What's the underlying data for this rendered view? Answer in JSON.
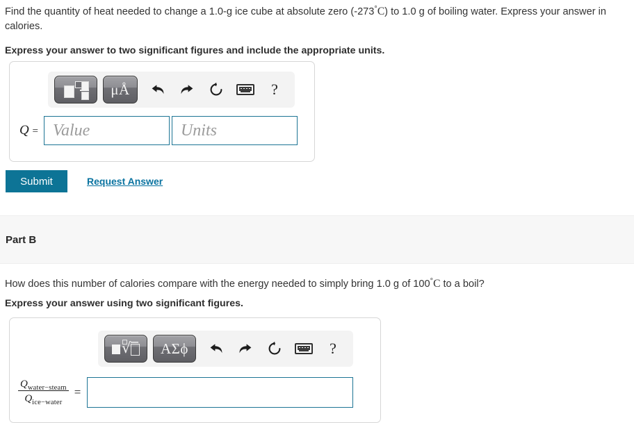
{
  "part_a": {
    "question_prefix": "Find the quantity of heat needed to change a 1.0-g ice cube at absolute zero (-273",
    "question_degree": "°",
    "question_unit": "C",
    "question_suffix": ") to 1.0 g of boiling water. Express your answer in calories.",
    "instruction": "Express your answer to two significant figures and include the appropriate units.",
    "toolbar": {
      "template_button": "math-template",
      "units_button": "μÅ",
      "undo": "undo-arrow",
      "redo": "redo-arrow",
      "reset": "reset-circle",
      "keyboard": "keyboard",
      "help": "?"
    },
    "answer_label": "Q",
    "answer_equals": "=",
    "value_placeholder": "Value",
    "units_placeholder": "Units",
    "value_text": "",
    "units_text": "",
    "submit_label": "Submit",
    "request_answer_label": "Request Answer"
  },
  "part_b": {
    "title": "Part B",
    "question_prefix": "How does this number of calories compare with the energy needed to simply bring 1.0 g of 100",
    "question_degree": "°",
    "question_unit": "C",
    "question_suffix": " to a boil?",
    "instruction": "Express your answer using two significant figures.",
    "toolbar": {
      "template_button": "sqrt-template",
      "greek_button": "ΑΣϕ",
      "undo": "undo-arrow",
      "redo": "redo-arrow",
      "reset": "reset-circle",
      "keyboard": "keyboard",
      "help": "?"
    },
    "fraction": {
      "numerator_symbol": "Q",
      "numerator_subscript": "water−steam",
      "denominator_symbol": "Q",
      "denominator_subscript": "ice−water"
    },
    "equals": "=",
    "answer_text": ""
  },
  "colors": {
    "submit_bg": "#0d7496",
    "link": "#0a73a0",
    "input_border": "#1c7494",
    "part_band_bg": "#f7f7f7",
    "toolbar_bg": "#f3f3f3",
    "panel_border": "#d6d6d6"
  }
}
